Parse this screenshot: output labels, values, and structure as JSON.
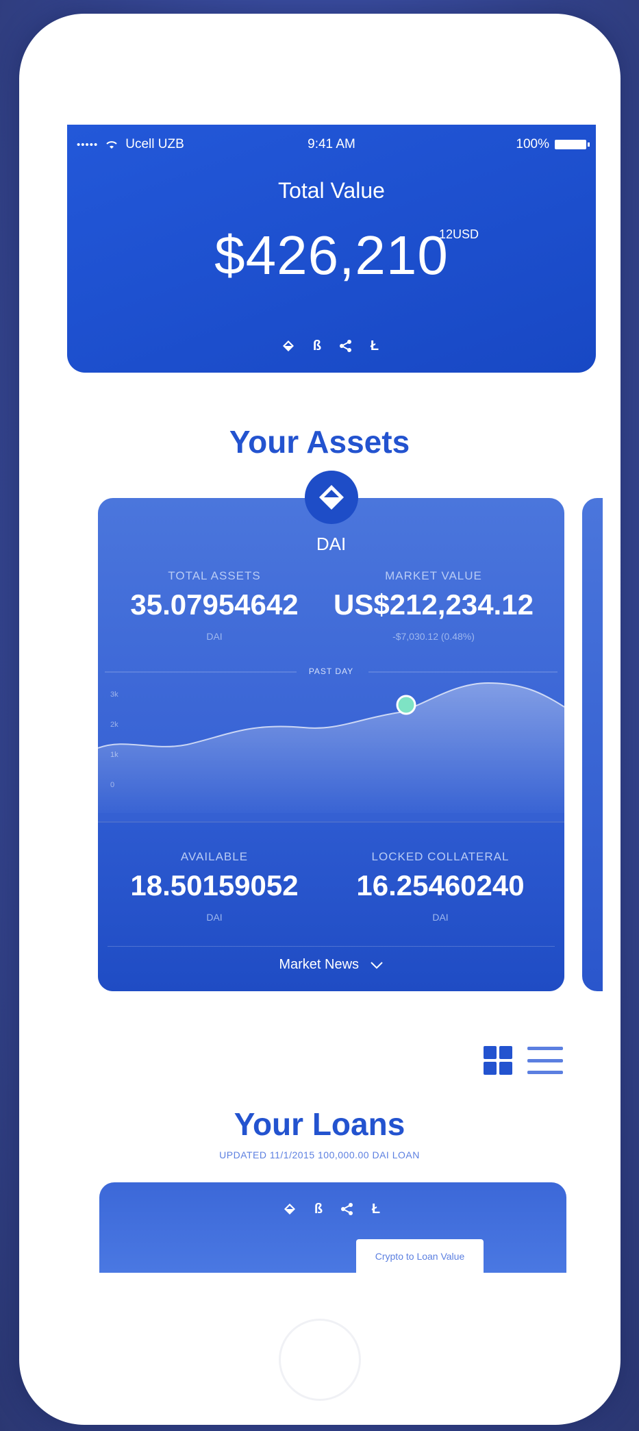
{
  "status_bar": {
    "signal": "•••••",
    "carrier": "Ucell UZB",
    "time": "9:41 AM",
    "battery": "100%"
  },
  "hero": {
    "title": "Total Value",
    "value": "$426,210",
    "cents": ".12USD"
  },
  "assets": {
    "section_title": "Your Assets",
    "card": {
      "name": "DAI",
      "total_assets_label": "TOTAL ASSETS",
      "total_assets_value": "35.07954642",
      "total_assets_unit": "DAI",
      "market_value_label": "MARKET VALUE",
      "market_value_value": "US$212,234.12",
      "market_value_change": "-$7,030.12 (0.48%)",
      "chart_label": "PAST DAY",
      "y_ticks": [
        "3k",
        "2k",
        "1k",
        "0"
      ],
      "available_label": "AVAILABLE",
      "available_value": "18.50159052",
      "available_unit": "DAI",
      "locked_label": "LOCKED COLLATERAL",
      "locked_value": "16.25460240",
      "locked_unit": "DAI",
      "news_label": "Market News"
    }
  },
  "loans": {
    "section_title": "Your Loans",
    "updated": "UPDATED 11/1/2015 100,000.00 DAI LOAN",
    "tag": "Crypto to Loan Value"
  },
  "icons": [
    "dai-icon",
    "bitcoin-icon",
    "ripple-icon",
    "litecoin-icon",
    "grid-view-icon",
    "list-view-icon",
    "chevron-down-icon"
  ],
  "colors": {
    "primary": "#1848c4",
    "accent": "#2353cf",
    "chart_point": "#7ee3c4"
  }
}
